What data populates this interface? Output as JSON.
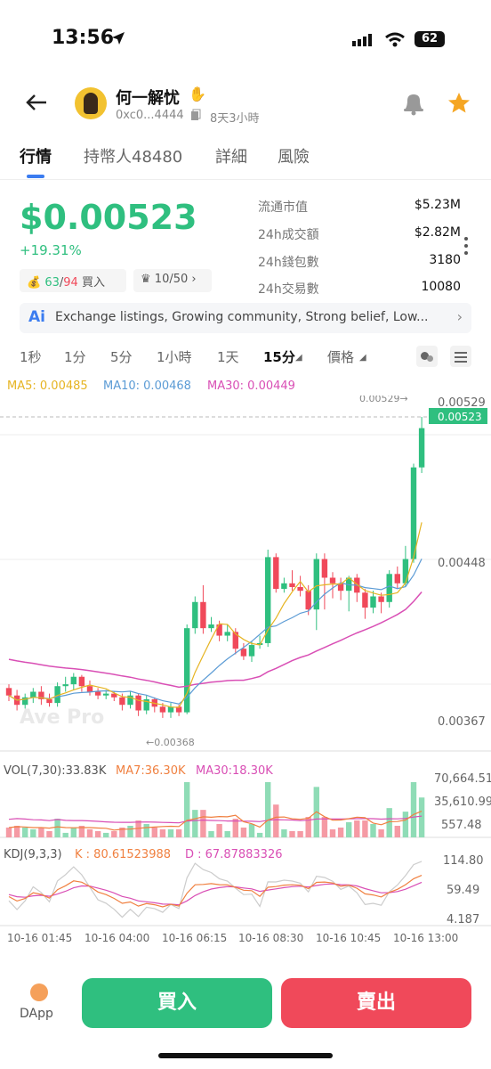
{
  "status": {
    "time": "13:56",
    "battery": "62"
  },
  "header": {
    "name": "何一解忧",
    "address": "0xc0...4444",
    "age": "8天3小時"
  },
  "tabs": [
    "行情",
    "持幣人48480",
    "詳細",
    "風險"
  ],
  "price": {
    "value": "$0.00523",
    "change": "+19.31%"
  },
  "pills": {
    "wallets_a": "63",
    "wallets_b": "94",
    "buy": "買入",
    "crown": "10/50"
  },
  "stats": [
    {
      "label": "流通市值",
      "value": "$5.23M"
    },
    {
      "label": "24h成交額",
      "value": "$2.82M"
    },
    {
      "label": "24h錢包數",
      "value": "3180"
    },
    {
      "label": "24h交易數",
      "value": "10080"
    }
  ],
  "ai_text": "Exchange listings, Growing community, Strong belief, Low...",
  "timeframes": [
    "1秒",
    "1分",
    "5分",
    "1小時",
    "1天",
    "15分",
    "價格"
  ],
  "ma": {
    "ma5": "MA5: 0.00485",
    "ma10": "MA10: 0.00468",
    "ma30": "MA30: 0.00449"
  },
  "price_axis": {
    "top_marker": "0.00529→",
    "p1": "0.00529",
    "current": "0.00523",
    "p2": "0.00448",
    "p3": "0.00367",
    "low_marker": "←0.00368"
  },
  "watermark": "Ave Pro",
  "vol": {
    "label": "VOL(7,30):33.83K",
    "ma7": "MA7:36.30K",
    "ma30": "MA30:18.30K",
    "a1": "70,664.51",
    "a2": "35,610.99",
    "a3": "557.48"
  },
  "kdj": {
    "label": "KDJ(9,3,3)",
    "k": "K : 80.61523988",
    "d": "D : 67.87883326",
    "a1": "114.80",
    "a2": "59.49",
    "a3": "4.187"
  },
  "time_axis": [
    "10-16 01:45",
    "10-16 04:00",
    "10-16 06:15",
    "10-16 08:30",
    "10-16 10:45",
    "10-16 13:00"
  ],
  "bottom": {
    "dapp": "DApp",
    "buy": "買入",
    "sell": "賣出"
  },
  "colors": {
    "green": "#2fbf7f",
    "red": "#f0495a",
    "ma5": "#e6b422",
    "ma10": "#5b9bd5",
    "ma30": "#d94fb5"
  }
}
